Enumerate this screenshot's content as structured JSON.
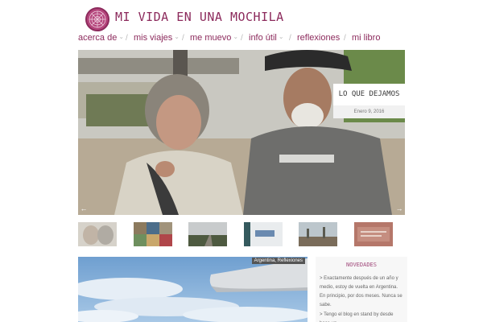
{
  "header": {
    "site_title": "MI VIDA EN UNA MOCHILA"
  },
  "nav": {
    "items": [
      {
        "label": "acerca de",
        "has_menu": true
      },
      {
        "label": "mis viajes",
        "has_menu": true
      },
      {
        "label": "me muevo",
        "has_menu": true
      },
      {
        "label": "info útil",
        "has_menu": true
      },
      {
        "label": "reflexiones",
        "has_menu": false
      },
      {
        "label": "mi libro",
        "has_menu": false
      }
    ]
  },
  "hero": {
    "title": "LO QUE DEJAMOS",
    "date": "Enero 9, 2016",
    "prev_label": "←",
    "next_label": "→"
  },
  "feature": {
    "categories": "Argentina, Reflexiones"
  },
  "sidebar": {
    "title": "NOVEDADES",
    "post1": "> Exactamente después de un año y medio, estoy de vuelta en Argentina. En principio, por dos meses. Nunca se sabe.",
    "post2": "> Tengo el blog en stand by desde hace un"
  },
  "colors": {
    "accent": "#8c2a5c",
    "logo": "#b5467c"
  }
}
